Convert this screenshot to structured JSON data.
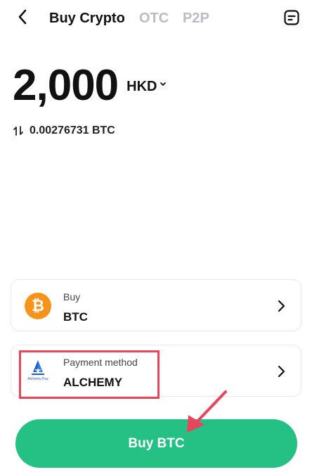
{
  "header": {
    "tabs": [
      {
        "label": "Buy Crypto",
        "active": true
      },
      {
        "label": "OTC",
        "active": false
      },
      {
        "label": "P2P",
        "active": false
      }
    ],
    "icons": {
      "back": "back-arrow-icon",
      "orders": "orders-icon"
    }
  },
  "amount": {
    "value": "2,000",
    "currency": "HKD"
  },
  "conversion": {
    "text": "0.00276731 BTC",
    "icon": "swap-arrows-icon"
  },
  "crypto_card": {
    "caption": "Buy",
    "value": "BTC",
    "icon": "bitcoin-icon"
  },
  "payment_card": {
    "caption": "Payment method",
    "value": "ALCHEMY",
    "logo_text": "Alchemy Pay",
    "icon": "alchemy-pay-logo"
  },
  "cta": {
    "label": "Buy BTC"
  },
  "colors": {
    "primary_green": "#25c184",
    "highlight_red": "#e8455d",
    "bitcoin_orange": "#f7931a",
    "alchemy_blue": "#1e5bd8",
    "inactive_tab": "#b8bcc4"
  }
}
